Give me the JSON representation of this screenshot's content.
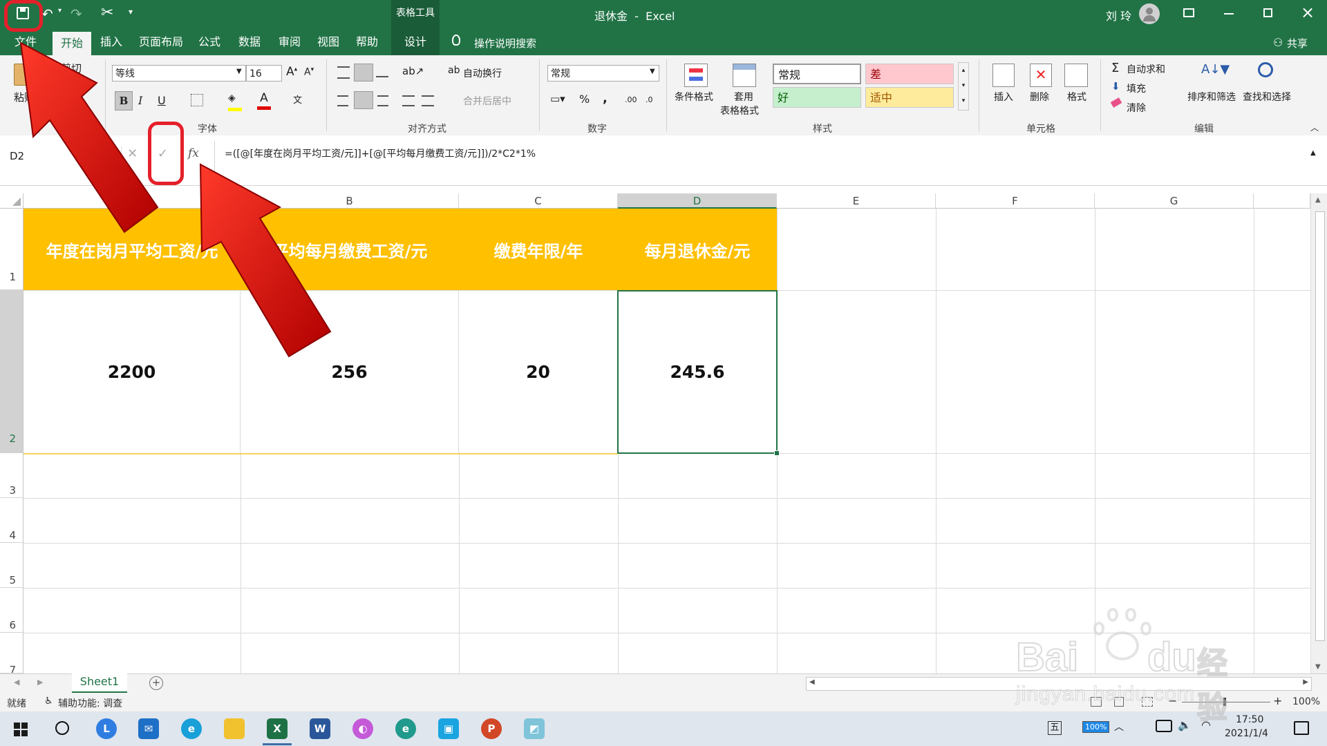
{
  "titlebar": {
    "context_tab": "表格工具",
    "doc_title": "退休金  -  Excel",
    "user": "刘 玲"
  },
  "tabs": [
    "文件",
    "开始",
    "插入",
    "页面布局",
    "公式",
    "数据",
    "审阅",
    "视图",
    "帮助",
    "设计"
  ],
  "tell_me": "操作说明搜索",
  "share": "共享",
  "ribbon": {
    "clipboard": {
      "paste": "粘贴",
      "cut": "剪切",
      "label": "剪"
    },
    "font": {
      "name": "等线",
      "size": "16",
      "bold": "B",
      "italic": "I",
      "underline": "U",
      "label": "字体"
    },
    "align": {
      "wrap": "自动换行",
      "merge": "合并后居中",
      "label": "对齐方式"
    },
    "number": {
      "format": "常规",
      "label": "数字"
    },
    "styles": {
      "cond": "条件格式",
      "table_fmt_1": "套用",
      "table_fmt_2": "表格格式",
      "normal": "常规",
      "bad": "差",
      "good": "好",
      "neutral": "适中",
      "label": "样式"
    },
    "cells": {
      "insert": "插入",
      "delete": "删除",
      "format": "格式",
      "label": "单元格"
    },
    "edit": {
      "autosum": "自动求和",
      "fill": "填充",
      "clear": "清除",
      "sort": "排序和筛选",
      "find": "查找和选择",
      "label": "编辑"
    }
  },
  "formula_bar": {
    "name_box": "D2",
    "fx": "fx",
    "formula": "=([@[年度在岗月平均工资/元]]+[@[平均每月缴费工资/元]])/2*C2*1%"
  },
  "columns": [
    "B",
    "C",
    "D",
    "E",
    "F",
    "G"
  ],
  "rows": [
    "1",
    "2",
    "3",
    "4",
    "5",
    "6",
    "7"
  ],
  "table": {
    "headers": [
      "年度在岗月平均工资/元",
      "平均每月缴费工资/元",
      "缴费年限/年",
      "每月退休金/元"
    ],
    "values": [
      "2200",
      "256",
      "20",
      "245.6"
    ]
  },
  "sheet_tab": "Sheet1",
  "status": {
    "ready": "就绪",
    "accessibility": "辅助功能: 调查",
    "zoom": "100%"
  },
  "taskbar": {
    "ime": "五",
    "battery": "100%",
    "time": "17:50",
    "date": "2021/1/4"
  },
  "watermark": {
    "text1": "Bai",
    "text2": "du",
    "text3": "经验",
    "url": "jingyan.baidu.com"
  },
  "colors": {
    "excel_green": "#217346",
    "header_fill": "#ffc000",
    "annotation_red": "#e5202a"
  }
}
